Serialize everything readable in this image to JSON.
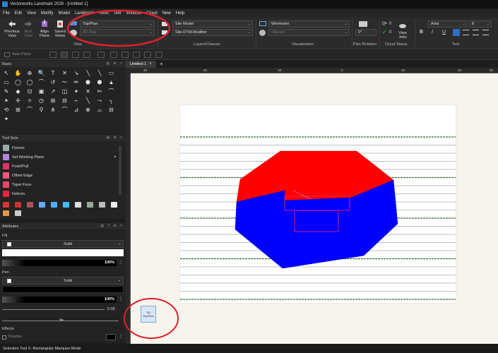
{
  "window": {
    "title": "Vectorworks Landmark 2026 - [Untitled 1]"
  },
  "menu": [
    "File",
    "Edit",
    "View",
    "Modify",
    "Model",
    "Landmark",
    "Tools",
    "Text",
    "Window",
    "Cloud",
    "New",
    "Help"
  ],
  "ribbon": {
    "view_group": {
      "previous_label": "Previous\nView",
      "next_label": "Next\nView",
      "align_label": "Align\nPlane",
      "saved_label": "Saved\nViews",
      "group_label": "View",
      "view_dropdown": "Top/Plan",
      "view_dropdown_2": "2D Plan"
    },
    "layers_group": {
      "layer_dropdown": "Site Model",
      "class_dropdown": "Site-DTM-Modifier",
      "group_label": "Layers/Classes"
    },
    "visualization_group": {
      "render_dropdown": "Wireframe",
      "light_dropdown": "<None>",
      "group_label": "Visualization"
    },
    "plan_rotation": {
      "value": "0°",
      "group_label": "Plan Rotation"
    },
    "cloud_group": {
      "sync_count": "0",
      "done_count": "0",
      "view_jobs_label": "View\nJobs",
      "group_label": "Cloud Status"
    },
    "text_group": {
      "font_dropdown": "Arial",
      "size_dropdown": "8",
      "group_label": "Text",
      "bold": "B",
      "italic": "I",
      "underline": "U"
    }
  },
  "toolbar2": {
    "auto_plane_label": "Auto-Plane"
  },
  "palettes": {
    "basic": {
      "title": "Basic"
    },
    "tool_sets": {
      "title": "Tool Sets",
      "items": [
        "Flyover",
        "Set Working Plane",
        "Push/Pull",
        "Offset Edge",
        "Taper Face",
        "Deform"
      ]
    },
    "attributes": {
      "title": "Attributes",
      "fill_label": "Fill",
      "fill_style": "Solid",
      "fill_opacity": "100%",
      "pen_label": "Pen",
      "pen_style": "Solid",
      "pen_opacity": "100%",
      "line_weight": "0.05",
      "effects_label": "Effects",
      "shadow_label": "Shadow"
    }
  },
  "document": {
    "tab_label": "Untitled 1",
    "ruler_h": [
      "30",
      "20",
      "10",
      "0",
      "10",
      "20",
      "30"
    ],
    "viewcube_top": "3D",
    "viewcube_bottom": "Top/Plan"
  },
  "status": {
    "text": "Selection Tool  X: Rectangular Marquee Mode"
  },
  "colors": {
    "annotation_red": "#e0202a",
    "shape_red": "#ff0000",
    "shape_blue": "#0000ff",
    "contour_green": "#2e6b3a",
    "accent_blue": "#2a7fd4"
  }
}
